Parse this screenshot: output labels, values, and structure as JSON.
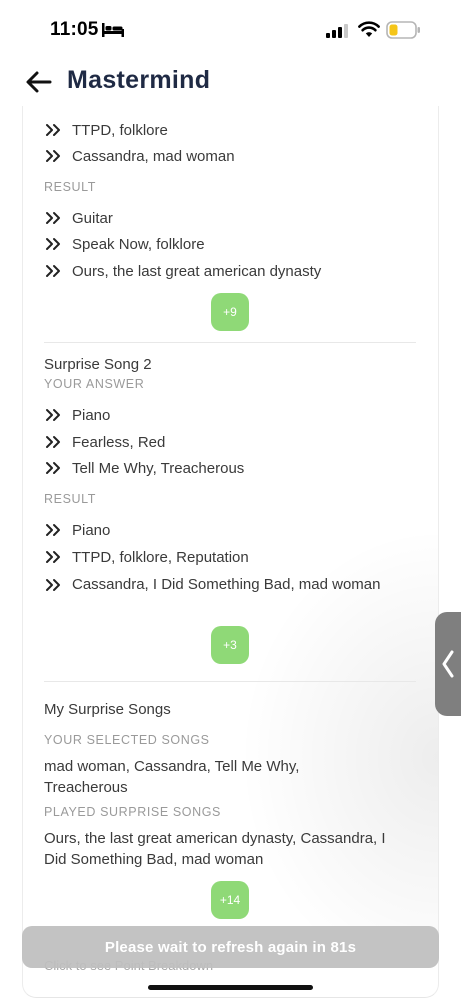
{
  "status_bar": {
    "time": "11:05"
  },
  "header": {
    "title": "Mastermind"
  },
  "section1": {
    "answer_items": [
      "TTPD, folklore",
      "Cassandra, mad woman"
    ],
    "result_label": "RESULT",
    "result_items": [
      "Guitar",
      "Speak Now, folklore",
      "Ours, the last great american dynasty"
    ],
    "points": "+9"
  },
  "section2": {
    "title": "Surprise Song 2",
    "answer_label": "YOUR ANSWER",
    "answer_items": [
      "Piano",
      "Fearless, Red",
      "Tell Me Why, Treacherous"
    ],
    "result_label": "RESULT",
    "result_items": [
      "Piano",
      "TTPD, folklore, Reputation",
      "Cassandra, I Did Something Bad, mad woman"
    ],
    "points": "+3"
  },
  "section3": {
    "title": "My Surprise Songs",
    "selected_label": "YOUR SELECTED SONGS",
    "selected_text": "mad woman, Cassandra, Tell Me Why, Treacherous",
    "played_label": "PLAYED SURPRISE SONGS",
    "played_text": "Ours, the last great american dynasty, Cassandra, I Did Something Bad, mad woman",
    "points": "+14"
  },
  "footer": {
    "breakdown_link": "Click to see Point Breakdown",
    "toast": "Please wait to refresh again in 81s"
  },
  "icons": {
    "back": "arrow-left-icon",
    "bullet": "double-chevron-right-icon",
    "handle": "chevron-left-icon"
  },
  "colors": {
    "title": "#1f2a44",
    "points_badge": "#8fd977",
    "toast_bg": "#bebebe",
    "battery_level": "#f5c518"
  }
}
